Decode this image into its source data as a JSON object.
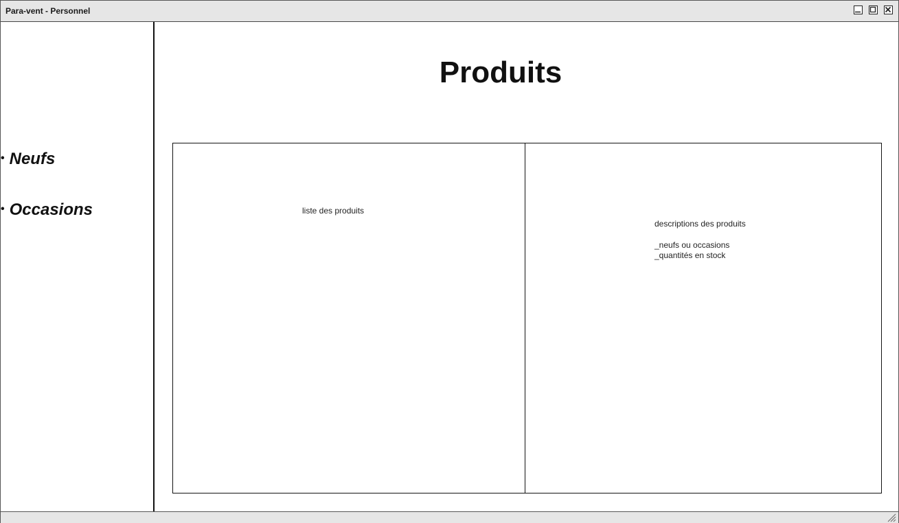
{
  "window": {
    "title": "Para-vent - Personnel"
  },
  "sidebar": {
    "items": [
      {
        "label": "Neufs"
      },
      {
        "label": "Occasions"
      }
    ]
  },
  "main": {
    "title": "Produits",
    "list_panel": {
      "label": "liste des produits"
    },
    "description_panel": {
      "heading": "descriptions des produits",
      "lines": [
        "_neufs ou occasions",
        "_quantités en stock"
      ]
    }
  },
  "icons": {
    "minimize": "minimize-icon",
    "maximize": "maximize-icon",
    "close": "close-icon",
    "resize": "resize-grip-icon"
  },
  "colors": {
    "titlebar_bg": "#e6e6e6",
    "text": "#111111",
    "border": "#111111"
  }
}
